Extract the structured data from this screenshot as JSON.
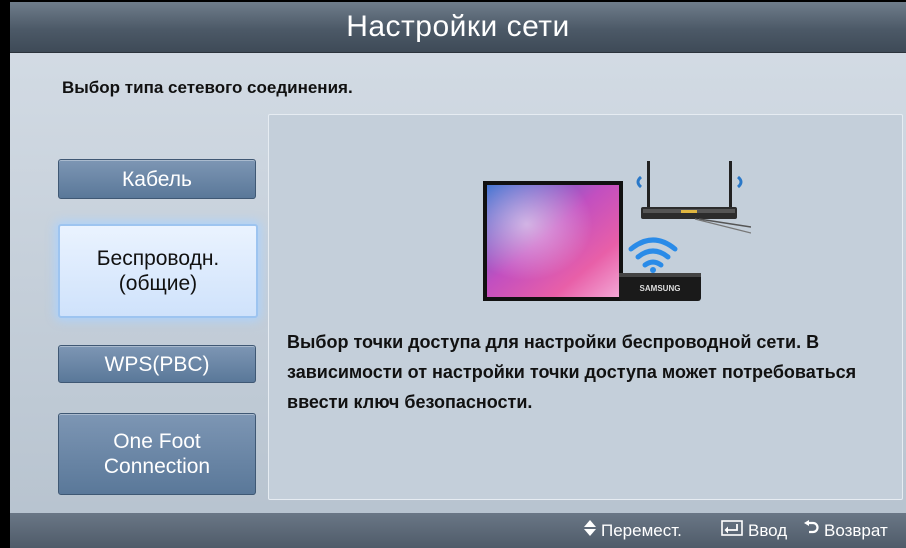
{
  "header": {
    "title": "Настройки сети"
  },
  "subtitle": "Выбор типа сетевого соединения.",
  "menu": {
    "items": [
      {
        "label": "Кабель",
        "selected": false
      },
      {
        "label": "Беспроводн.\n(общие)",
        "selected": true
      },
      {
        "label": "WPS(PBC)",
        "selected": false
      },
      {
        "label": "One Foot\nConnection",
        "selected": false
      }
    ]
  },
  "content": {
    "description": "Выбор точки доступа для настройки беспроводной сети. В зависимости от настройки точки доступа может потребоваться ввести ключ безопасности.",
    "illustration": {
      "icons": [
        "tv-icon",
        "wifi-icon",
        "router-icon",
        "samsung-adapter-icon"
      ],
      "brand_label": "SAMSUNG"
    }
  },
  "footer": {
    "move_label": "Перемест.",
    "enter_label": "Ввод",
    "return_label": "Возврат",
    "icons": [
      "updown-arrow-icon",
      "enter-icon",
      "return-icon"
    ]
  },
  "colors": {
    "panel_bg": "#c8d2dc",
    "title_bar": "#4c5967",
    "button": "#5a7899",
    "selected_button": "#d9e9fd",
    "selection_glow": "#aad2ff",
    "wifi": "#2a8be8"
  }
}
